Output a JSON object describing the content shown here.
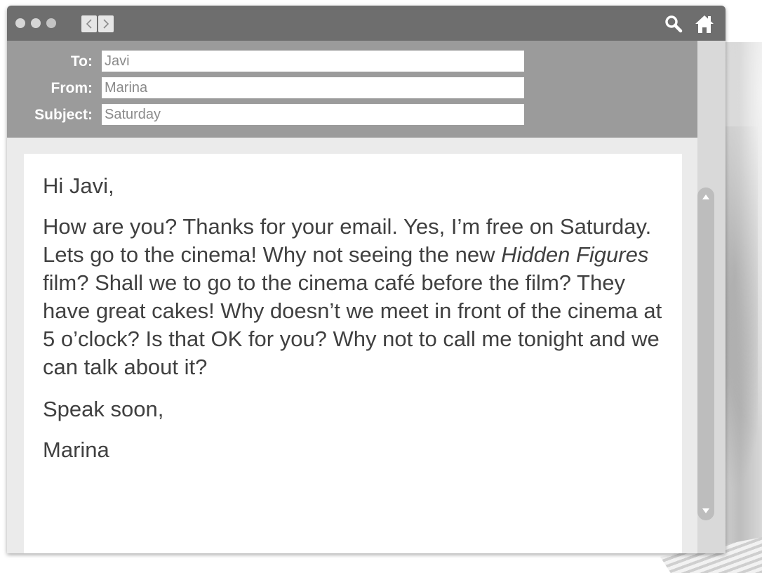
{
  "toolbar": {
    "icons": [
      "window-dot-icon",
      "window-dot-icon",
      "window-dot-icon",
      "back-arrow-icon",
      "forward-arrow-icon",
      "search-icon",
      "home-icon"
    ]
  },
  "email": {
    "to_label": "To:",
    "to_value": "Javi",
    "from_label": "From:",
    "from_value": "Marina",
    "subject_label": "Subject:",
    "subject_value": "Saturday"
  },
  "message": {
    "greeting": "Hi Javi,",
    "body_part1": "How are you? Thanks for your email. Yes, I’m free on Saturday. Lets go to the cinema! Why not seeing the new ",
    "body_title": "Hidden Figures",
    "body_part2": " film? Shall we to go to the cinema café before the film? They have great cakes! Why doesn’t we meet in front of the cinema at 5 o’clock? Is that OK for you? Why not to call me tonight and we can talk about it?",
    "closing": "Speak soon,",
    "signature": "Marina"
  },
  "colors": {
    "titlebar": "#6e6e6e",
    "header": "#9b9b9b",
    "body_bg": "#ebebeb",
    "text": "#404040"
  }
}
